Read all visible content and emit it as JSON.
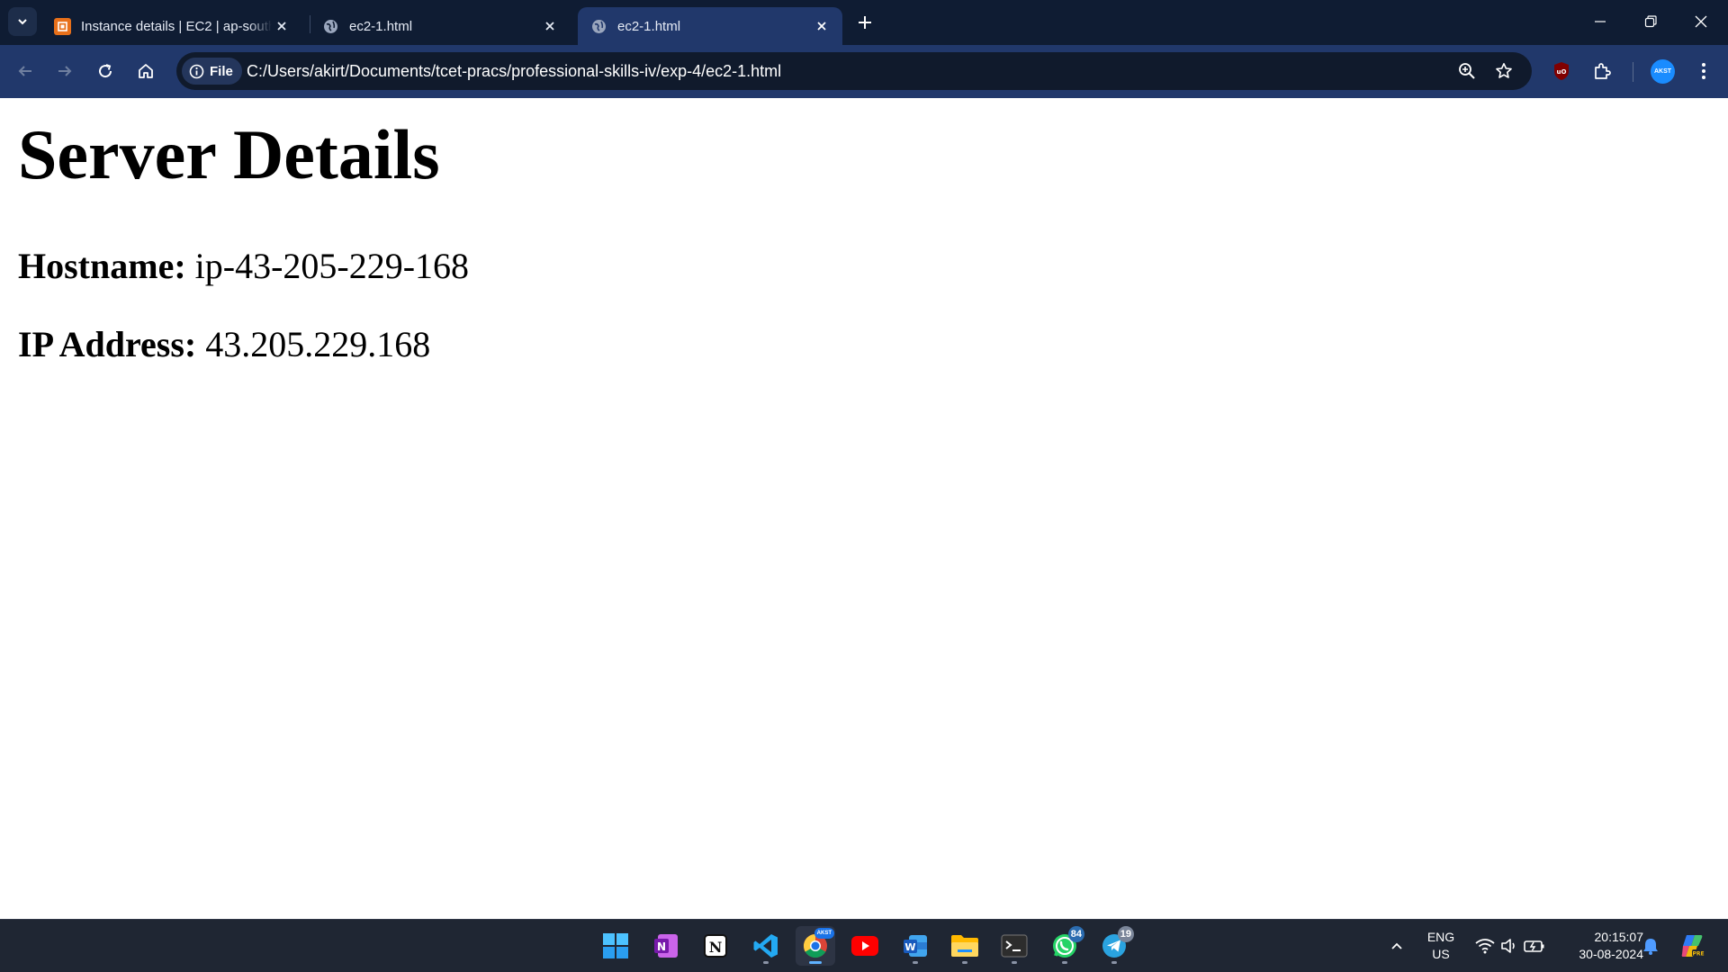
{
  "browser": {
    "tabs": [
      {
        "title": "Instance details | EC2 | ap-south-1",
        "favicon": "aws-ec2-icon",
        "active": false
      },
      {
        "title": "ec2-1.html",
        "favicon": "globe-icon",
        "active": false
      },
      {
        "title": "ec2-1.html",
        "favicon": "globe-icon",
        "active": true
      }
    ],
    "address_bar": {
      "scheme_label": "File",
      "url": "C:/Users/akirt/Documents/tcet-pracs/professional-skills-iv/exp-4/ec2-1.html"
    },
    "profile_label": "AKST",
    "colors": {
      "frame": "#0f1c33",
      "toolbar": "#21386b",
      "omnibox": "#101a2c"
    }
  },
  "page": {
    "heading": "Server Details",
    "hostname_label": "Hostname:",
    "hostname_value": "ip-43-205-229-168",
    "ip_label": "IP Address:",
    "ip_value": "43.205.229.168"
  },
  "taskbar": {
    "apps": [
      {
        "name": "windows-start-icon"
      },
      {
        "name": "onenote-icon"
      },
      {
        "name": "notion-icon"
      },
      {
        "name": "vscode-icon",
        "running": true
      },
      {
        "name": "chrome-icon",
        "running": true,
        "active": true
      },
      {
        "name": "youtube-icon"
      },
      {
        "name": "word-icon",
        "running": true
      },
      {
        "name": "file-explorer-icon",
        "running": true
      },
      {
        "name": "terminal-icon",
        "running": true
      },
      {
        "name": "whatsapp-icon",
        "running": true,
        "badge": "84"
      },
      {
        "name": "telegram-icon",
        "running": true,
        "badge": "19"
      }
    ],
    "tray": {
      "language": "ENG",
      "region": "US",
      "time": "20:15:07",
      "date": "30-08-2024"
    }
  }
}
